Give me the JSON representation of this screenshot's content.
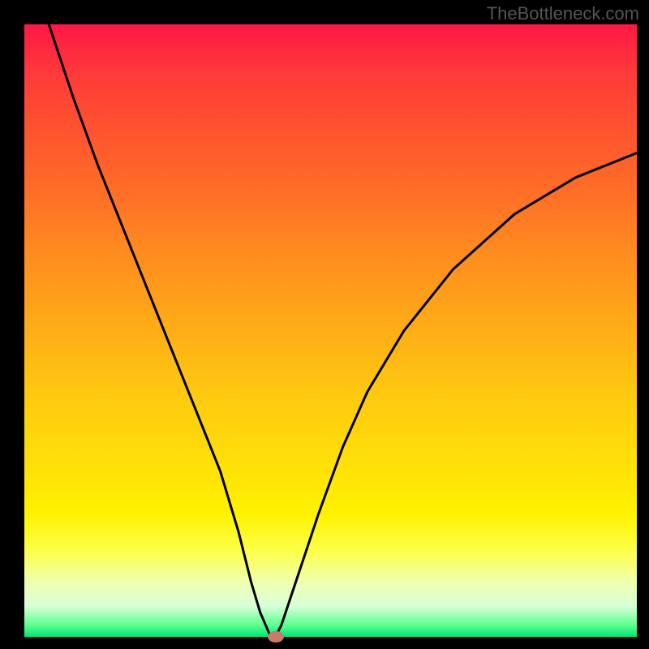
{
  "watermark": "TheBottleneck.com",
  "chart_data": {
    "type": "line",
    "title": "",
    "xlabel": "",
    "ylabel": "",
    "xlim": [
      0,
      100
    ],
    "ylim": [
      0,
      100
    ],
    "series": [
      {
        "name": "bottleneck-curve",
        "x": [
          4,
          8,
          12,
          16,
          20,
          24,
          28,
          32,
          35,
          37,
          38.5,
          40,
          41,
          42,
          44,
          48,
          52,
          56,
          62,
          70,
          80,
          90,
          100
        ],
        "values": [
          100,
          88,
          77,
          67,
          57,
          47,
          37,
          27,
          17,
          9,
          4,
          0.5,
          0,
          2,
          8,
          20,
          31,
          40,
          50,
          60,
          69,
          75,
          79
        ]
      }
    ],
    "marker": {
      "x": 41,
      "y": 0
    },
    "gradient_note": "background vertical gradient red→orange→yellow→green indicating severity"
  }
}
